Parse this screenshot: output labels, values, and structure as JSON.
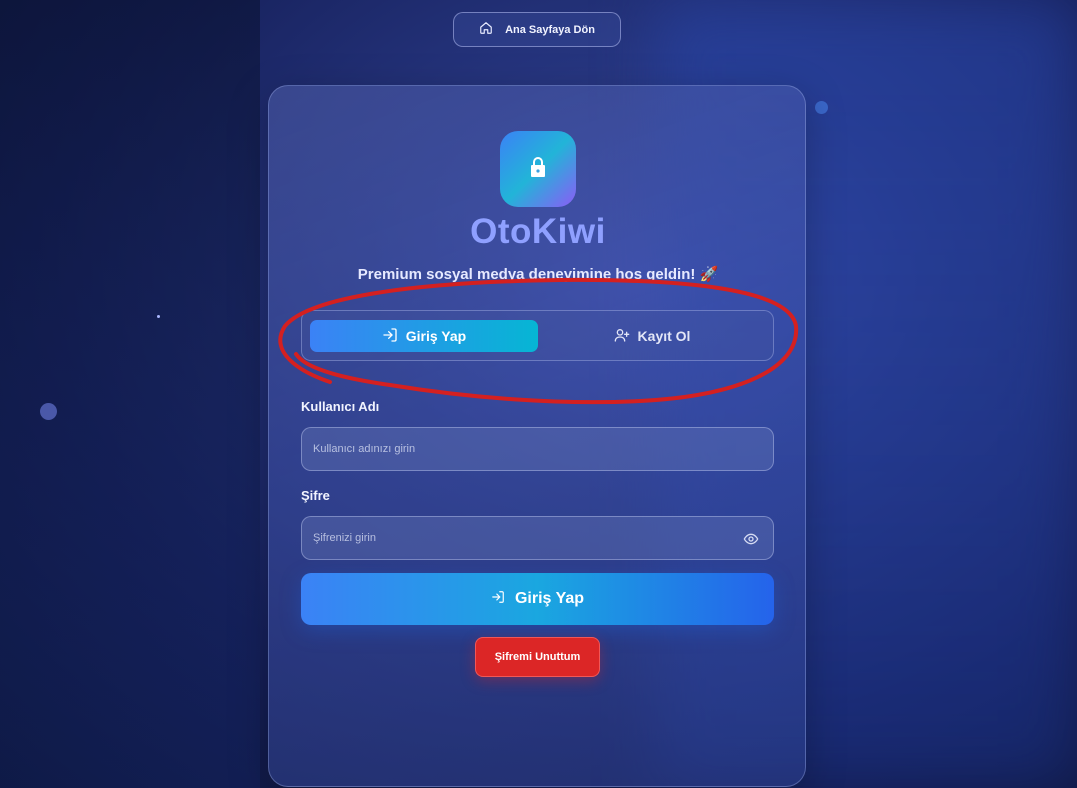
{
  "header": {
    "home_label": "Ana Sayfaya Dön"
  },
  "brand": {
    "name": "OtoKiwi",
    "tagline": "Premium sosyal medya deneyimine hoş geldin! 🚀"
  },
  "tabs": [
    {
      "label": "Giriş Yap",
      "active": true
    },
    {
      "label": "Kayıt Ol",
      "active": false
    }
  ],
  "form": {
    "username_label": "Kullanıcı Adı",
    "username_placeholder": "Kullanıcı adınızı girin",
    "username_value": "",
    "password_label": "Şifre",
    "password_placeholder": "Şifrenizi girin",
    "password_value": "",
    "submit_label": "Giriş Yap",
    "forgot_label": "Şifremi Unuttum"
  },
  "colors": {
    "brand": "#8fa0ff",
    "accent_start": "#3b82f6",
    "accent_end": "#06b6d4",
    "danger": "#dc2626",
    "annotation": "#d42020"
  },
  "icons": [
    "home-icon",
    "lock-icon",
    "login-icon",
    "user-plus-icon",
    "eye-icon"
  ]
}
